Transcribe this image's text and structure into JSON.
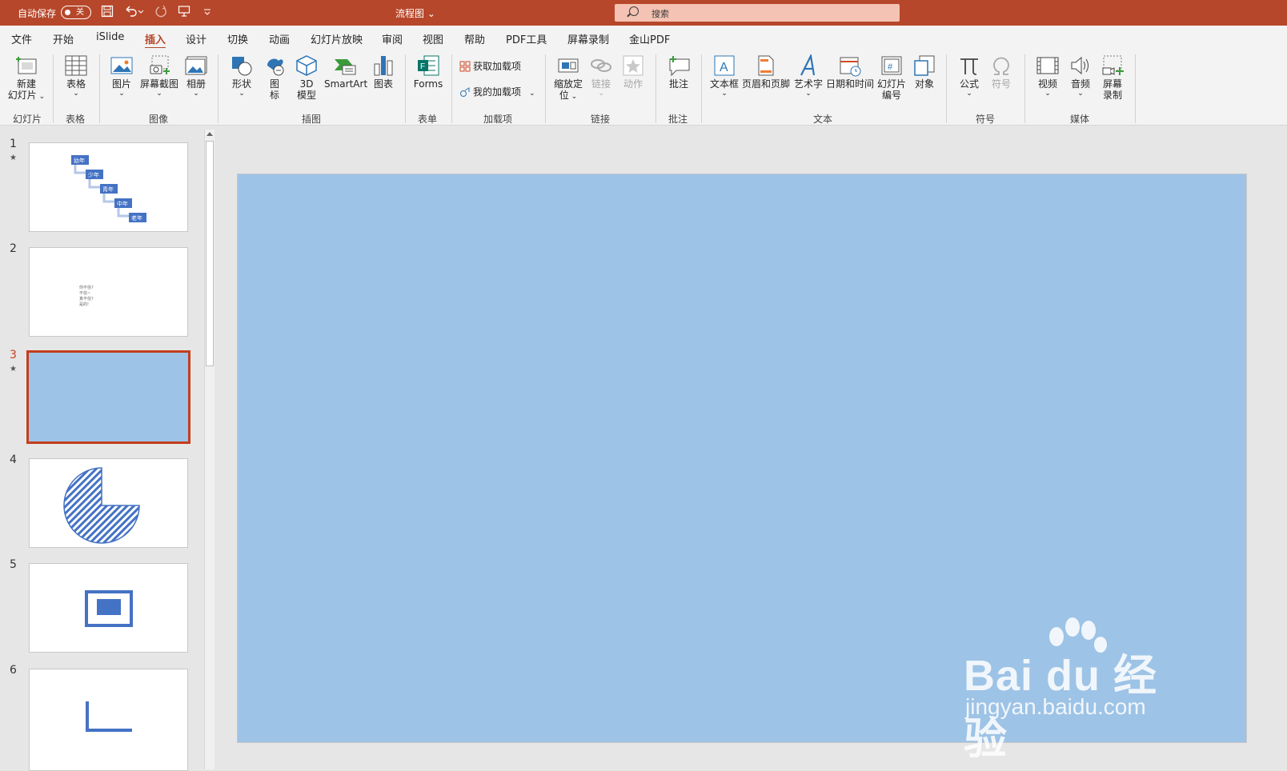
{
  "titlebar": {
    "autosave_label": "自动保存",
    "autosave_state": "关",
    "doc_title": "流程图",
    "search_placeholder": "搜索"
  },
  "tabs": [
    "文件",
    "开始",
    "iSlide",
    "插入",
    "设计",
    "切换",
    "动画",
    "幻灯片放映",
    "审阅",
    "视图",
    "帮助",
    "PDF工具",
    "屏幕录制",
    "金山PDF"
  ],
  "active_tab": "插入",
  "ribbon": {
    "new_slide": "新建\n幻灯片",
    "table": "表格",
    "picture": "图片",
    "screenshot": "屏幕截图",
    "album": "相册",
    "shapes": "形状",
    "icons": "图\n标",
    "model3d": "3D\n模型",
    "smartart": "SmartArt",
    "chart": "图表",
    "forms": "Forms",
    "get_addins": "获取加载项",
    "my_addins": "我的加载项",
    "zoom": "缩放定\n位",
    "link": "链接",
    "action": "动作",
    "comment": "批注",
    "textbox": "文本框",
    "header_footer": "页眉和页脚",
    "wordart": "艺术字",
    "datetime": "日期和时间",
    "slide_number": "幻灯片\n编号",
    "object": "对象",
    "equation": "公式",
    "symbol": "符号",
    "video": "视频",
    "audio": "音频",
    "screen_record": "屏幕\n录制",
    "groups": {
      "slides": "幻灯片",
      "tables": "表格",
      "images": "图像",
      "illustrations": "插图",
      "forms": "表单",
      "addins": "加载项",
      "links": "链接",
      "comments": "批注",
      "text": "文本",
      "symbols": "符号",
      "media": "媒体"
    }
  },
  "slides": [
    {
      "num": "1",
      "star": "★",
      "steps": [
        "幼年",
        "少年",
        "青年",
        "中年",
        "老年"
      ]
    },
    {
      "num": "2",
      "lines": [
        "你不信?",
        "不信~",
        "真不信?",
        "是的!"
      ]
    },
    {
      "num": "3",
      "star": "★"
    },
    {
      "num": "4"
    },
    {
      "num": "5"
    },
    {
      "num": "6"
    }
  ],
  "watermark": {
    "brand": "Bai du 经验",
    "url": "jingyan.baidu.com"
  },
  "colors": {
    "accent": "#b7472a",
    "slide_bg": "#9dc3e6",
    "shape_blue": "#4472c4"
  }
}
